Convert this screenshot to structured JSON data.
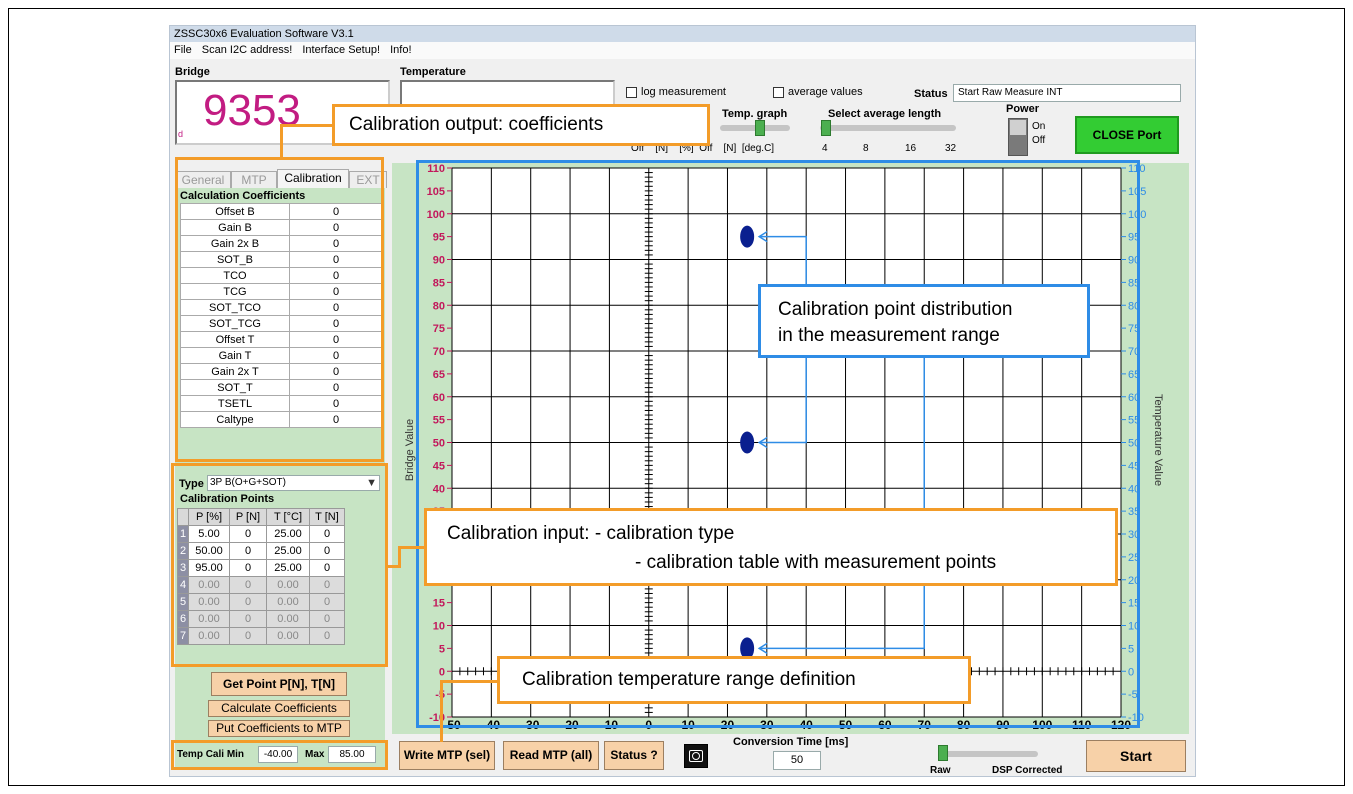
{
  "window": {
    "title": "ZSSC30x6 Evaluation Software V3.1",
    "menu": [
      "File",
      "Scan I2C address!",
      "Interface Setup!",
      "Info!"
    ]
  },
  "bridge": {
    "label": "Bridge",
    "value": "9353"
  },
  "temperature": {
    "label": "Temperature"
  },
  "options": {
    "log_measurement": "log measurement",
    "average_values": "average values"
  },
  "status": {
    "label": "Status",
    "value": "Start Raw Measure INT"
  },
  "temp_graph": {
    "label": "Temp. graph",
    "ticks": [
      "Off",
      "[N]",
      "[%]",
      "Off",
      "[N]",
      "[deg.C]"
    ]
  },
  "avg_length": {
    "label": "Select average length",
    "ticks": [
      "4",
      "8",
      "16",
      "32"
    ]
  },
  "power": {
    "label": "Power",
    "on": "On",
    "off": "Off"
  },
  "close_port": "CLOSE Port",
  "tabs": [
    "General",
    "MTP",
    "Calibration",
    "EXT"
  ],
  "coefficients": {
    "header": "Calculation Coefficients",
    "rows": [
      {
        "name": "Offset B",
        "value": "0"
      },
      {
        "name": "Gain B",
        "value": "0"
      },
      {
        "name": "Gain 2x B",
        "value": "0"
      },
      {
        "name": "SOT_B",
        "value": "0"
      },
      {
        "name": "TCO",
        "value": "0"
      },
      {
        "name": "TCG",
        "value": "0"
      },
      {
        "name": "SOT_TCO",
        "value": "0"
      },
      {
        "name": "SOT_TCG",
        "value": "0"
      },
      {
        "name": "Offset T",
        "value": "0"
      },
      {
        "name": "Gain T",
        "value": "0"
      },
      {
        "name": "Gain 2x T",
        "value": "0"
      },
      {
        "name": "SOT_T",
        "value": "0"
      },
      {
        "name": "TSETL",
        "value": "0"
      },
      {
        "name": "Caltype",
        "value": "0"
      }
    ]
  },
  "cal_type": {
    "label": "Type",
    "value": "3P B(O+G+SOT)"
  },
  "cal_points": {
    "header": "Calibration Points",
    "columns": [
      "P [%]",
      "P [N]",
      "T [°C]",
      "T [N]"
    ],
    "rows": [
      [
        "5.00",
        "0",
        "25.00",
        "0"
      ],
      [
        "50.00",
        "0",
        "25.00",
        "0"
      ],
      [
        "95.00",
        "0",
        "25.00",
        "0"
      ],
      [
        "0.00",
        "0",
        "0.00",
        "0"
      ],
      [
        "0.00",
        "0",
        "0.00",
        "0"
      ],
      [
        "0.00",
        "0",
        "0.00",
        "0"
      ],
      [
        "0.00",
        "0",
        "0.00",
        "0"
      ]
    ]
  },
  "buttons": {
    "get_point": "Get Point P[N], T[N]",
    "calc_coeff": "Calculate Coefficients",
    "put_coeff": "Put Coefficients to MTP",
    "write_mtp": "Write MTP (sel)",
    "read_mtp": "Read MTP (all)",
    "status_q": "Status ?",
    "start": "Start"
  },
  "temp_cali": {
    "min_label": "Temp Cali Min",
    "min": "-40.00",
    "max_label": "Max",
    "max": "85.00"
  },
  "conversion": {
    "label": "Conversion Time [ms]",
    "value": "50"
  },
  "output_mode": {
    "raw": "Raw",
    "dsp": "DSP Corrected"
  },
  "chart_data": {
    "type": "scatter",
    "title": "",
    "ylabel": "Bridge Value",
    "y2label": "Temperature Value",
    "xlim": [
      -50,
      120
    ],
    "ylim": [
      -10,
      110
    ],
    "xticks": [
      -50,
      -40,
      -30,
      -20,
      -10,
      0,
      10,
      20,
      30,
      40,
      50,
      60,
      70,
      80,
      90,
      100,
      110,
      120
    ],
    "yticks": [
      -10,
      -5,
      0,
      5,
      10,
      15,
      20,
      25,
      30,
      35,
      40,
      45,
      50,
      55,
      60,
      65,
      70,
      75,
      80,
      85,
      90,
      95,
      100,
      105,
      110
    ],
    "points": [
      {
        "x": 25,
        "y": 95
      },
      {
        "x": 25,
        "y": 50
      },
      {
        "x": 25,
        "y": 5
      }
    ],
    "grid": true,
    "colors": {
      "left_axis": "#c2185b",
      "right_axis": "#2e8ce6",
      "points": "#0a1f8f"
    }
  },
  "annotations": {
    "coefficients": "Calibration output: coefficients",
    "distribution_1": "Calibration point distribution",
    "distribution_2": "in the measurement range",
    "input_1": "Calibration input:  - calibration type",
    "input_2": "- calibration table with measurement points",
    "temp_range": "Calibration temperature range definition"
  }
}
